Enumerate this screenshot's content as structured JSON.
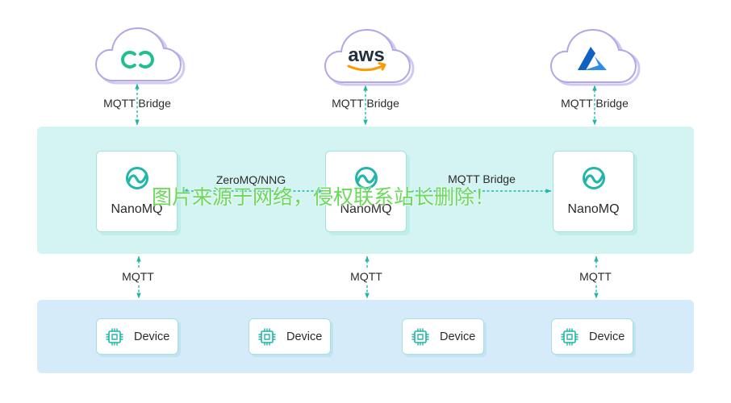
{
  "diagram": {
    "clouds": [
      {
        "icon": "emqx-cloud-logo-icon",
        "bridge_label": "MQTT Bridge"
      },
      {
        "icon": "aws-logo-icon",
        "logo_text": "aws",
        "bridge_label": "MQTT Bridge"
      },
      {
        "icon": "azure-logo-icon",
        "bridge_label": "MQTT Bridge"
      }
    ],
    "brokers": [
      {
        "icon": "nanomq-logo-icon",
        "label": "NanoMQ"
      },
      {
        "icon": "nanomq-logo-icon",
        "label": "NanoMQ"
      },
      {
        "icon": "nanomq-logo-icon",
        "label": "NanoMQ"
      }
    ],
    "broker_links": [
      {
        "label": "ZeroMQ/NNG"
      },
      {
        "label": "MQTT Bridge"
      }
    ],
    "device_links": [
      {
        "label": "MQTT"
      },
      {
        "label": "MQTT"
      },
      {
        "label": "MQTT"
      }
    ],
    "devices": [
      {
        "icon": "chip-icon",
        "label": "Device"
      },
      {
        "icon": "chip-icon",
        "label": "Device"
      },
      {
        "icon": "chip-icon",
        "label": "Device"
      },
      {
        "icon": "chip-icon",
        "label": "Device"
      }
    ]
  },
  "watermark": "图片来源于网络，侵权联系站长删除！",
  "colors": {
    "accent": "#22b6a8",
    "broker-panel": "#d3f4f2",
    "device-panel": "#d5ebfa",
    "cloud-outline": "#b3a5e8",
    "cloud-shadow": "#d2c8f5",
    "box-border": "#a6e0d9",
    "box-shadow": "#bdeee8",
    "device-shadow": "#bfe3f0",
    "emqx-green": "#1fc08f",
    "aws-orange": "#ff9900",
    "aws-text": "#232f3e",
    "azure-dark": "#0f62c2",
    "azure-light": "#2f8de8",
    "watermark": "#6ad85a",
    "text": "#2b2b2b"
  }
}
